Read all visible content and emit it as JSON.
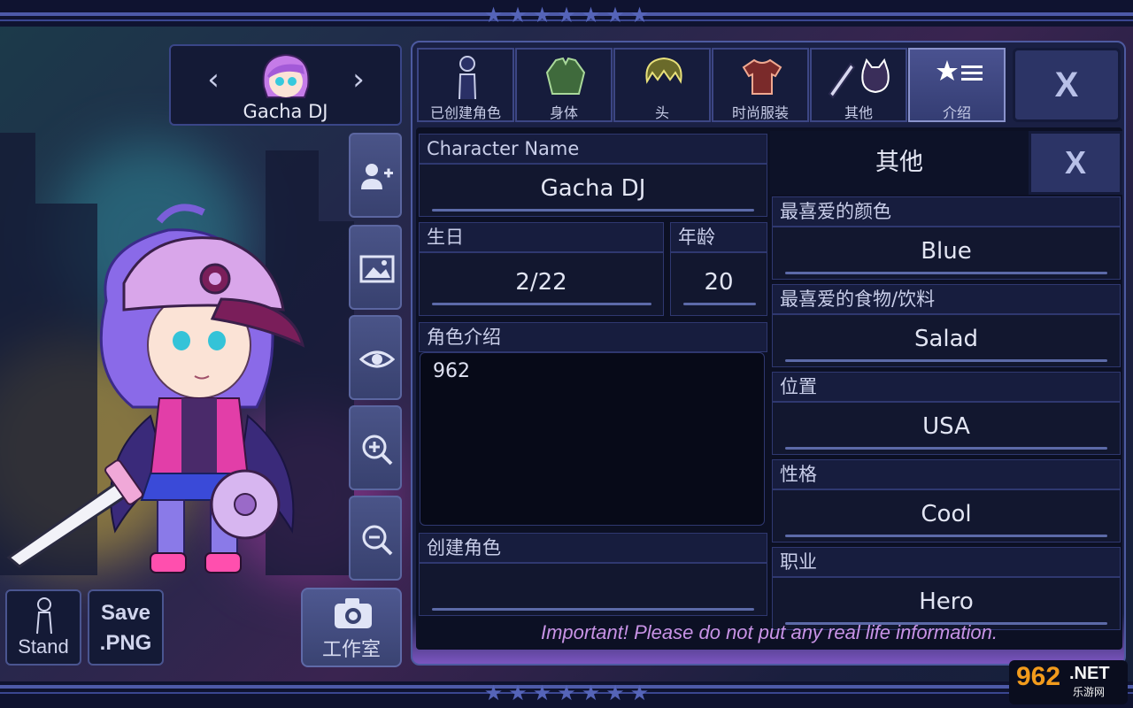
{
  "character_selector": {
    "name": "Gacha DJ",
    "prev_icon": "chevron-left-icon",
    "next_icon": "chevron-right-icon"
  },
  "tools": [
    "add-person-icon",
    "image-icon",
    "eye-icon",
    "zoom-in-icon",
    "zoom-out-icon"
  ],
  "bottom_buttons": {
    "stand": "Stand",
    "save_line1": "Save",
    "save_line2": ".PNG",
    "studio": "工作室"
  },
  "tabs": [
    {
      "label": "已创建角色",
      "icon": "person-icon"
    },
    {
      "label": "身体",
      "icon": "jacket-icon"
    },
    {
      "label": "头",
      "icon": "hair-icon"
    },
    {
      "label": "时尚服装",
      "icon": "shirt-icon"
    },
    {
      "label": "其他",
      "icon": "sword-cat-icon"
    },
    {
      "label": "介绍",
      "icon": "star-list-icon"
    }
  ],
  "active_tab": "介绍",
  "close_label": "X",
  "profile": {
    "name_label": "Character Name",
    "name_value": "Gacha DJ",
    "birthday_label": "生日",
    "birthday_value": "2/22",
    "age_label": "年龄",
    "age_value": "20",
    "intro_label": "角色介绍",
    "intro_value": "962",
    "creator_label": "创建角色",
    "creator_value": ""
  },
  "other": {
    "title": "其他",
    "close_label": "X",
    "fields": [
      {
        "label": "最喜爱的颜色",
        "value": "Blue"
      },
      {
        "label": "最喜爱的食物/饮料",
        "value": "Salad"
      },
      {
        "label": "位置",
        "value": "USA"
      },
      {
        "label": "性格",
        "value": "Cool"
      },
      {
        "label": "职业",
        "value": "Hero"
      }
    ]
  },
  "notice": "Important! Please do not put any real life information.",
  "watermark": {
    "num": "962",
    "net": ".NET",
    "sub": "乐游网"
  },
  "colors": {
    "accent": "#4d5aa0",
    "notice": "#c893e6",
    "watermark": "#f29b1c"
  }
}
